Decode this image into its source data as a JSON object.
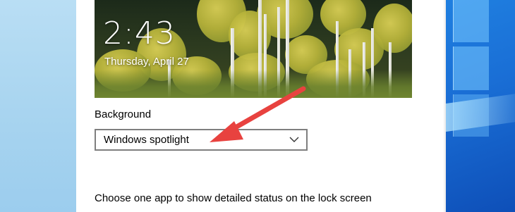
{
  "lockscreen_preview": {
    "time": "2:43",
    "date": "Thursday, April 27"
  },
  "background_setting": {
    "label": "Background",
    "selected_value": "Windows spotlight",
    "chevron_icon": "chevron-down-icon"
  },
  "detailed_status": {
    "label": "Choose one app to show detailed status on the lock screen"
  },
  "annotation": {
    "arrow_color": "#e8423f"
  },
  "colors": {
    "panel_background": "#ffffff",
    "dropdown_border": "#7f7f7f",
    "desktop_left": "#a6d3ef",
    "desktop_right": "#1a6fd6"
  }
}
